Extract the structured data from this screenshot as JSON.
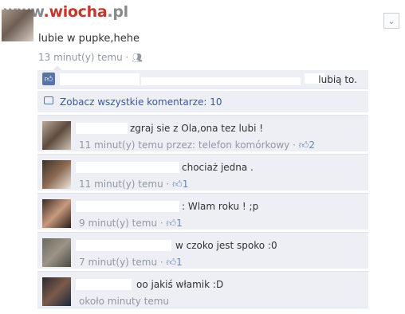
{
  "watermark": {
    "part1": "www",
    "part2": ".wiocha",
    "part3": ".pl"
  },
  "post": {
    "text": "lubie w pupke,hehe",
    "meta": "13 minut(y) temu",
    "audience_icon": "friends-icon"
  },
  "likes_bar": {
    "end_text": "lubią to.",
    "icon": "thumbs-up-icon"
  },
  "view_all": {
    "label": "Zobacz wszystkie komentarze: 10",
    "icon": "comment-icon"
  },
  "comments": [
    {
      "text": "zgraj sie z Ola,ona tez lubi !",
      "meta": "11 minut(y) temu przez: telefon komórkowy",
      "likes": "2"
    },
    {
      "text": "chociaż jedna .",
      "meta": "11 minut(y) temu",
      "likes": "1"
    },
    {
      "text": ": Wlam roku ! ;p",
      "meta": "9 minut(y) temu",
      "likes": "1"
    },
    {
      "text": "w czoko jest spoko :0",
      "meta": "7 minut(y) temu",
      "likes": "1"
    },
    {
      "text": "oo jakiś włamik :D",
      "meta": "około minuty temu",
      "likes": ""
    }
  ],
  "colors": {
    "accent": "#3b5998",
    "panel": "#edeff4",
    "muted": "#9197a3"
  }
}
